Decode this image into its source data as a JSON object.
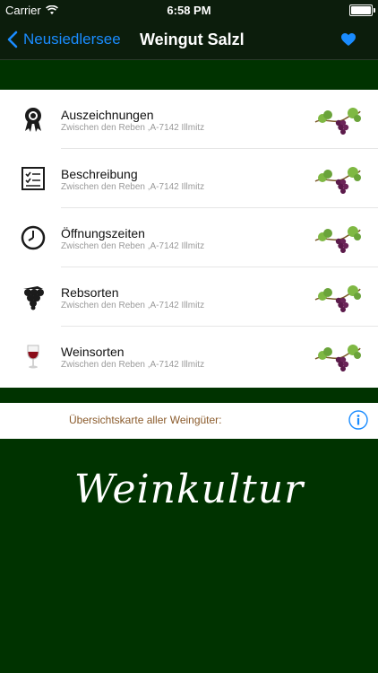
{
  "status": {
    "carrier": "Carrier",
    "time": "6:58 PM",
    "battery_level": 1.0
  },
  "nav": {
    "back_label": "Neusiedlersee",
    "title": "Weingut Salzl",
    "favorite_icon": "heart-icon"
  },
  "list": {
    "items": [
      {
        "title": "Auszeichnungen",
        "subtitle": "Zwischen den Reben ,A-7142 Illmitz",
        "icon": "award-icon"
      },
      {
        "title": "Beschreibung",
        "subtitle": "Zwischen den Reben ,A-7142 Illmitz",
        "icon": "document-icon"
      },
      {
        "title": "Öffnungszeiten",
        "subtitle": "Zwischen den Reben ,A-7142 Illmitz",
        "icon": "clock-icon"
      },
      {
        "title": "Rebsorten",
        "subtitle": "Zwischen den Reben ,A-7142 Illmitz",
        "icon": "grapes-icon"
      },
      {
        "title": "Weinsorten",
        "subtitle": "Zwischen den Reben ,A-7142 Illmitz",
        "icon": "wine-glass-icon"
      }
    ]
  },
  "map_bar": {
    "label": "Übersichtskarte aller Weingüter:",
    "icon": "info-icon"
  },
  "logo": {
    "text": "Weinkultur"
  },
  "colors": {
    "background": "#003300",
    "accent": "#1a8cff",
    "map_label": "#8a5a2a"
  }
}
